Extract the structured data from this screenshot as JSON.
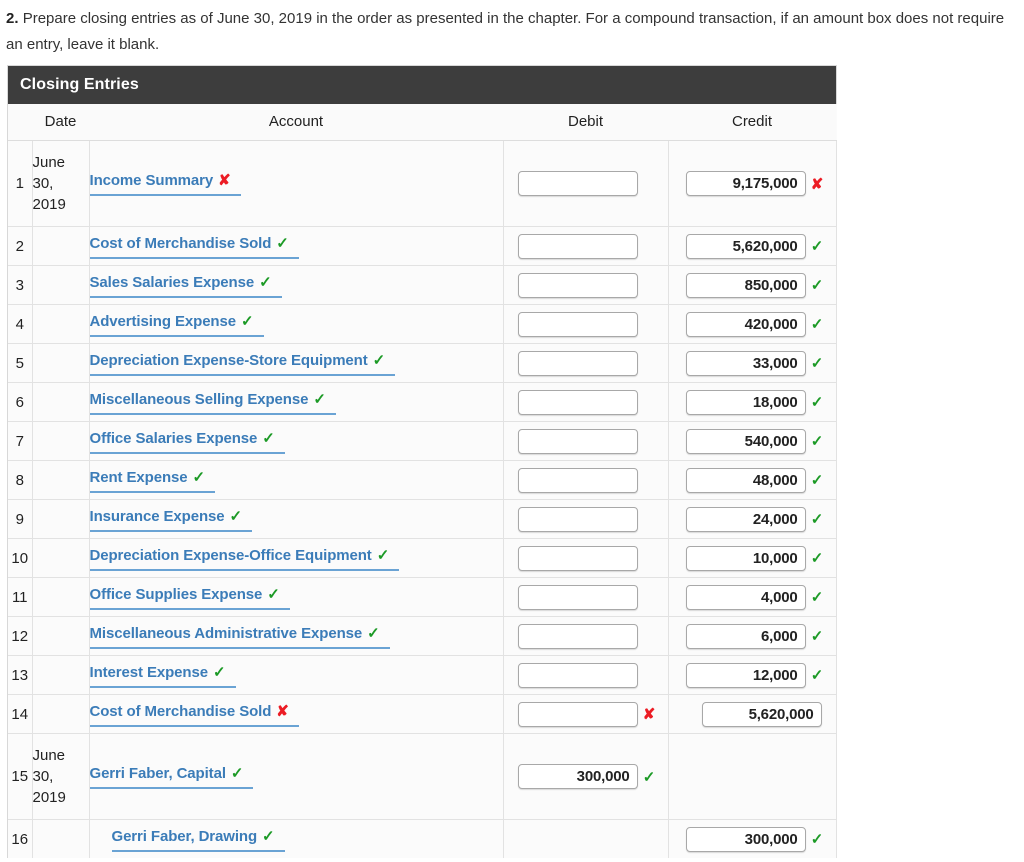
{
  "instructions": {
    "number": "2.",
    "text": "Prepare closing entries as of June 30, 2019 in the order as presented in the chapter. For a compound transaction, if an amount box does not require an entry, leave it blank."
  },
  "table": {
    "title": "Closing Entries",
    "columns": {
      "row_number": "",
      "date": "Date",
      "account": "Account",
      "debit": "Debit",
      "credit": "Credit"
    },
    "colors": {
      "title_bar_bg": "#3d3d3d",
      "account_link": "#3b7cb8",
      "account_underline": "#6aa3d4",
      "correct_mark": "#1c9a26",
      "incorrect_mark": "#ec1c24",
      "row_bg": "#fbfbfb",
      "grid_line": "#e2e2e2"
    },
    "marks": {
      "correct": "✓",
      "incorrect": "✘"
    },
    "rows": [
      {
        "n": "1",
        "date": "June 30, 2019",
        "account": "Income Summary",
        "account_mark": "incorrect",
        "account_indent": false,
        "tall": true,
        "debit": {
          "has_box": true,
          "value": "",
          "mark": "none"
        },
        "credit": {
          "has_box": true,
          "value": "9,175,000",
          "mark": "incorrect"
        }
      },
      {
        "n": "2",
        "date": "",
        "account": "Cost of Merchandise Sold",
        "account_mark": "correct",
        "account_indent": false,
        "tall": false,
        "debit": {
          "has_box": true,
          "value": "",
          "mark": "none"
        },
        "credit": {
          "has_box": true,
          "value": "5,620,000",
          "mark": "correct"
        }
      },
      {
        "n": "3",
        "date": "",
        "account": "Sales Salaries Expense",
        "account_mark": "correct",
        "account_indent": false,
        "tall": false,
        "debit": {
          "has_box": true,
          "value": "",
          "mark": "none"
        },
        "credit": {
          "has_box": true,
          "value": "850,000",
          "mark": "correct"
        }
      },
      {
        "n": "4",
        "date": "",
        "account": "Advertising Expense",
        "account_mark": "correct",
        "account_indent": false,
        "tall": false,
        "debit": {
          "has_box": true,
          "value": "",
          "mark": "none"
        },
        "credit": {
          "has_box": true,
          "value": "420,000",
          "mark": "correct"
        }
      },
      {
        "n": "5",
        "date": "",
        "account": "Depreciation Expense-Store Equipment",
        "account_mark": "correct",
        "account_indent": false,
        "tall": false,
        "debit": {
          "has_box": true,
          "value": "",
          "mark": "none"
        },
        "credit": {
          "has_box": true,
          "value": "33,000",
          "mark": "correct"
        }
      },
      {
        "n": "6",
        "date": "",
        "account": "Miscellaneous Selling Expense",
        "account_mark": "correct",
        "account_indent": false,
        "tall": false,
        "debit": {
          "has_box": true,
          "value": "",
          "mark": "none"
        },
        "credit": {
          "has_box": true,
          "value": "18,000",
          "mark": "correct"
        }
      },
      {
        "n": "7",
        "date": "",
        "account": "Office Salaries Expense",
        "account_mark": "correct",
        "account_indent": false,
        "tall": false,
        "debit": {
          "has_box": true,
          "value": "",
          "mark": "none"
        },
        "credit": {
          "has_box": true,
          "value": "540,000",
          "mark": "correct"
        }
      },
      {
        "n": "8",
        "date": "",
        "account": "Rent Expense",
        "account_mark": "correct",
        "account_indent": false,
        "tall": false,
        "debit": {
          "has_box": true,
          "value": "",
          "mark": "none"
        },
        "credit": {
          "has_box": true,
          "value": "48,000",
          "mark": "correct"
        }
      },
      {
        "n": "9",
        "date": "",
        "account": "Insurance Expense",
        "account_mark": "correct",
        "account_indent": false,
        "tall": false,
        "debit": {
          "has_box": true,
          "value": "",
          "mark": "none"
        },
        "credit": {
          "has_box": true,
          "value": "24,000",
          "mark": "correct"
        }
      },
      {
        "n": "10",
        "date": "",
        "account": "Depreciation Expense-Office Equipment",
        "account_mark": "correct",
        "account_indent": false,
        "tall": false,
        "debit": {
          "has_box": true,
          "value": "",
          "mark": "none"
        },
        "credit": {
          "has_box": true,
          "value": "10,000",
          "mark": "correct"
        }
      },
      {
        "n": "11",
        "date": "",
        "account": "Office Supplies Expense",
        "account_mark": "correct",
        "account_indent": false,
        "tall": false,
        "debit": {
          "has_box": true,
          "value": "",
          "mark": "none"
        },
        "credit": {
          "has_box": true,
          "value": "4,000",
          "mark": "correct"
        }
      },
      {
        "n": "12",
        "date": "",
        "account": "Miscellaneous Administrative Expense",
        "account_mark": "correct",
        "account_indent": false,
        "tall": false,
        "debit": {
          "has_box": true,
          "value": "",
          "mark": "none"
        },
        "credit": {
          "has_box": true,
          "value": "6,000",
          "mark": "correct"
        }
      },
      {
        "n": "13",
        "date": "",
        "account": "Interest Expense",
        "account_mark": "correct",
        "account_indent": false,
        "tall": false,
        "debit": {
          "has_box": true,
          "value": "",
          "mark": "none"
        },
        "credit": {
          "has_box": true,
          "value": "12,000",
          "mark": "correct"
        }
      },
      {
        "n": "14",
        "date": "",
        "account": "Cost of Merchandise Sold",
        "account_mark": "incorrect",
        "account_indent": false,
        "tall": false,
        "debit": {
          "has_box": true,
          "value": "",
          "mark": "incorrect"
        },
        "credit": {
          "has_box": true,
          "value": "5,620,000",
          "mark": "blank"
        }
      },
      {
        "n": "15",
        "date": "June 30, 2019",
        "account": "Gerri Faber, Capital",
        "account_mark": "correct",
        "account_indent": false,
        "tall": true,
        "debit": {
          "has_box": true,
          "value": "300,000",
          "mark": "correct"
        },
        "credit": {
          "has_box": false,
          "value": "",
          "mark": "blank"
        }
      },
      {
        "n": "16",
        "date": "",
        "account": "Gerri Faber, Drawing",
        "account_mark": "correct",
        "account_indent": true,
        "tall": false,
        "debit": {
          "has_box": false,
          "value": "",
          "mark": "blank"
        },
        "credit": {
          "has_box": true,
          "value": "300,000",
          "mark": "correct"
        }
      }
    ]
  }
}
